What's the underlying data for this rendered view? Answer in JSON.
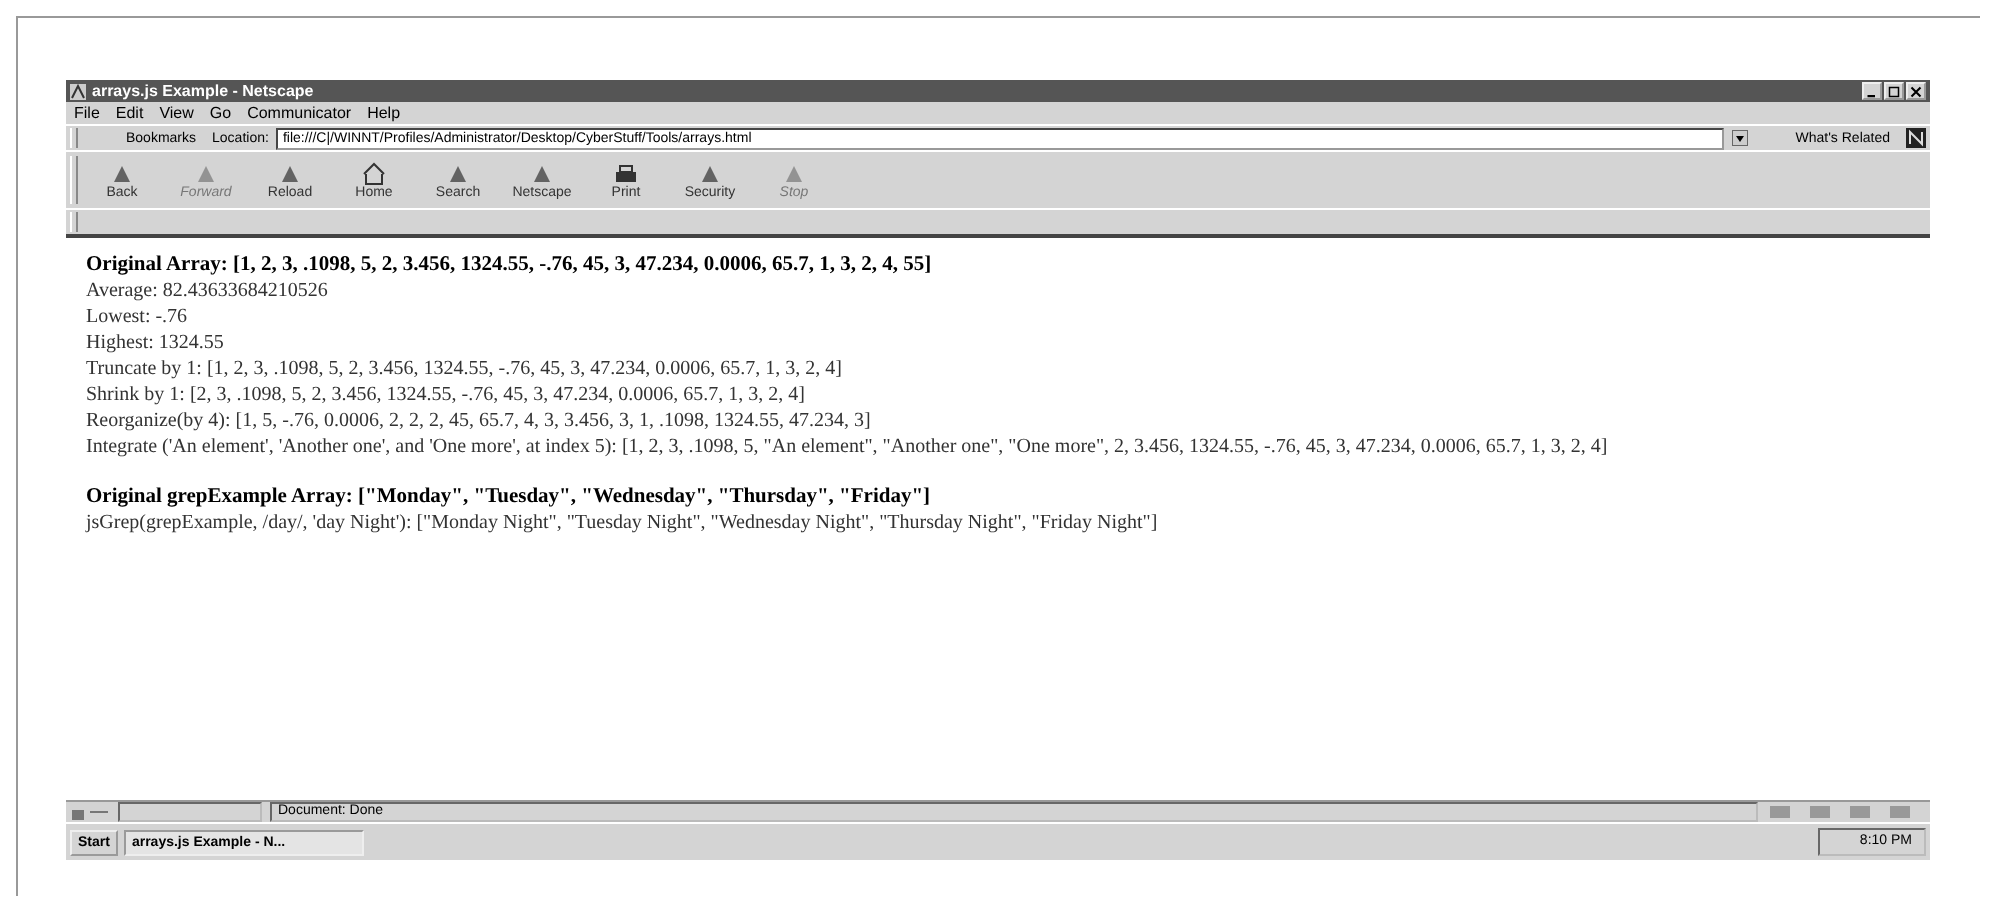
{
  "window": {
    "title": "arrays.js Example - Netscape"
  },
  "menu": [
    "File",
    "Edit",
    "View",
    "Go",
    "Communicator",
    "Help"
  ],
  "location_bar": {
    "bookmarks": "Bookmarks",
    "label": "Location:",
    "url": "file:///C|/WINNT/Profiles/Administrator/Desktop/CyberStuff/Tools/arrays.html",
    "related": "What's Related"
  },
  "toolbar": [
    {
      "label": "Back",
      "disabled": false
    },
    {
      "label": "Forward",
      "disabled": true
    },
    {
      "label": "Reload",
      "disabled": false
    },
    {
      "label": "Home",
      "disabled": false
    },
    {
      "label": "Search",
      "disabled": false
    },
    {
      "label": "Netscape",
      "disabled": false
    },
    {
      "label": "Print",
      "disabled": false
    },
    {
      "label": "Security",
      "disabled": false
    },
    {
      "label": "Stop",
      "disabled": true
    }
  ],
  "content": [
    {
      "kind": "heading",
      "text": "Original Array: [1, 2, 3, .1098, 5, 2, 3.456, 1324.55, -.76, 45, 3, 47.234, 0.0006, 65.7, 1, 3, 2, 4, 55]"
    },
    {
      "kind": "line",
      "text": "Average: 82.43633684210526"
    },
    {
      "kind": "line",
      "text": "Lowest: -.76"
    },
    {
      "kind": "line",
      "text": "Highest: 1324.55"
    },
    {
      "kind": "line",
      "text": "Truncate by 1: [1, 2, 3, .1098, 5, 2, 3.456, 1324.55, -.76, 45, 3, 47.234, 0.0006, 65.7, 1, 3, 2, 4]"
    },
    {
      "kind": "line",
      "text": "Shrink by 1: [2, 3, .1098, 5, 2, 3.456, 1324.55, -.76, 45, 3, 47.234, 0.0006, 65.7, 1, 3, 2, 4]"
    },
    {
      "kind": "line",
      "text": "Reorganize(by 4): [1, 5, -.76, 0.0006, 2, 2, 2, 45, 65.7, 4, 3, 3.456, 3, 1, .1098, 1324.55, 47.234, 3]"
    },
    {
      "kind": "line",
      "text": "Integrate ('An element', 'Another one', and 'One more', at index 5): [1, 2, 3, .1098, 5, \"An element\", \"Another one\", \"One more\", 2, 3.456, 1324.55, -.76, 45, 3, 47.234, 0.0006, 65.7, 1, 3, 2, 4]"
    },
    {
      "kind": "heading",
      "text": "Original grepExample Array: [\"Monday\", \"Tuesday\", \"Wednesday\", \"Thursday\", \"Friday\"]"
    },
    {
      "kind": "line",
      "text": "jsGrep(grepExample, /day/, 'day Night'): [\"Monday Night\", \"Tuesday Night\", \"Wednesday Night\", \"Thursday Night\", \"Friday Night\"]"
    }
  ],
  "status_bar": {
    "text": "Document: Done"
  },
  "taskbar": {
    "start": "Start",
    "task": "arrays.js Example - N...",
    "clock": "8:10 PM"
  }
}
